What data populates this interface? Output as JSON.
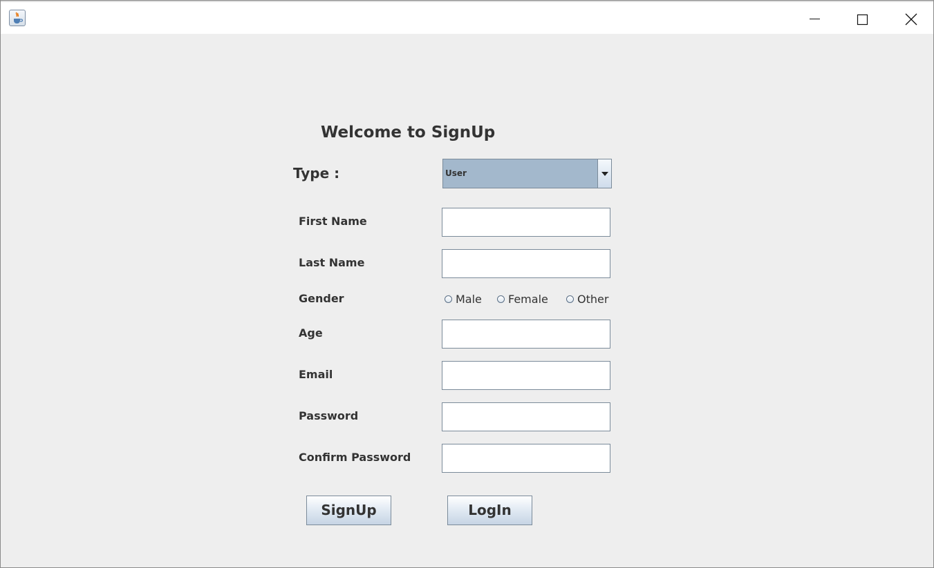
{
  "window": {
    "icon": "java-cup-icon",
    "controls": [
      "minimize-icon",
      "maximize-icon",
      "close-icon"
    ]
  },
  "form": {
    "title": "Welcome to SignUp",
    "type_label": "Type :",
    "type_selected": "User",
    "fields": {
      "first_name": "First Name",
      "last_name": "Last Name",
      "gender": "Gender",
      "age": "Age",
      "email": "Email",
      "password": "Password",
      "confirm_password": "Confirm Password"
    },
    "gender_options": [
      "Male",
      "Female",
      "Other"
    ],
    "buttons": {
      "signup": "SignUp",
      "login": "LogIn"
    }
  },
  "colors": {
    "background": "#eeeeee",
    "combo_fill": "#a3b8cc",
    "text": "#333333"
  }
}
